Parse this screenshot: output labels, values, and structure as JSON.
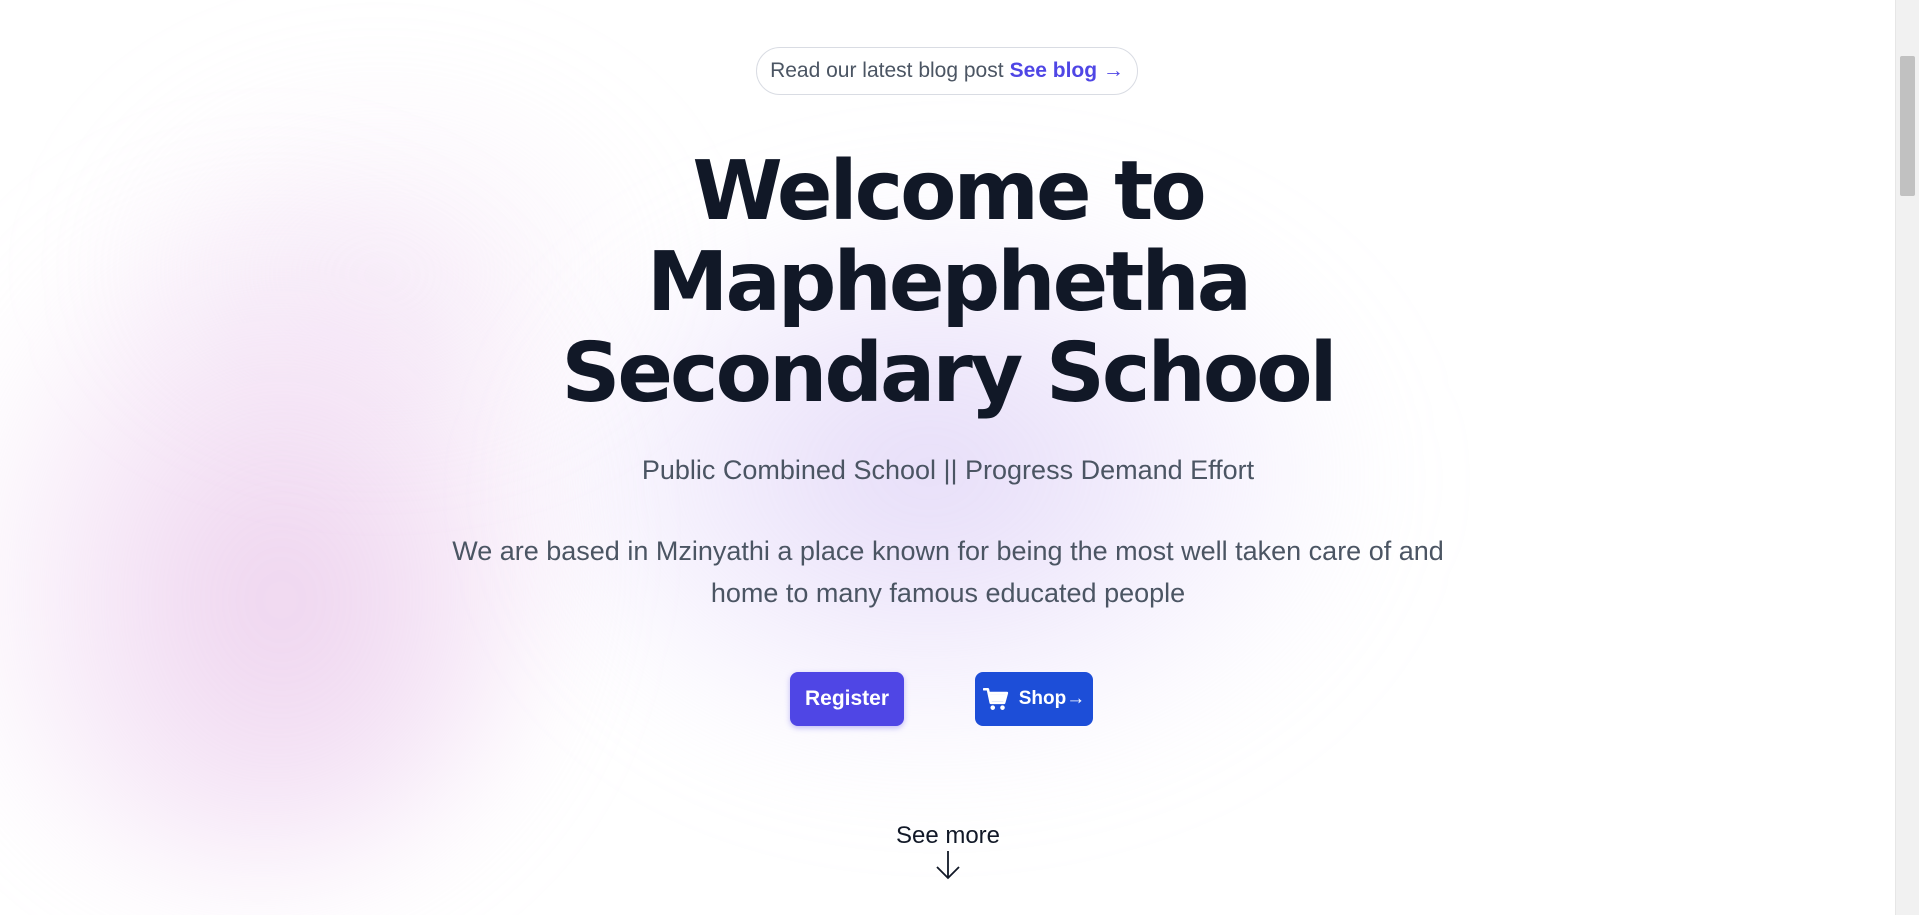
{
  "announcement": {
    "text": "Read our latest blog post",
    "link_label": "See blog →"
  },
  "hero": {
    "title_lines": [
      "Welcome to",
      "Maphephetha",
      "Secondary School"
    ],
    "subtitle": "Public Combined School || Progress Demand Effort",
    "description": "We are based in Mzinyathi a place known for being the most well taken care of and home to many famous educated people"
  },
  "buttons": {
    "register_label": "Register",
    "shop_label": "Shop→",
    "shop_icon": "cart-icon"
  },
  "see_more": {
    "label": "See more",
    "icon": "arrow-down-icon"
  },
  "colors": {
    "primary_indigo": "#4f46e5",
    "shop_blue": "#1d4ed8",
    "heading": "#111827",
    "body_text": "#4b5563"
  }
}
